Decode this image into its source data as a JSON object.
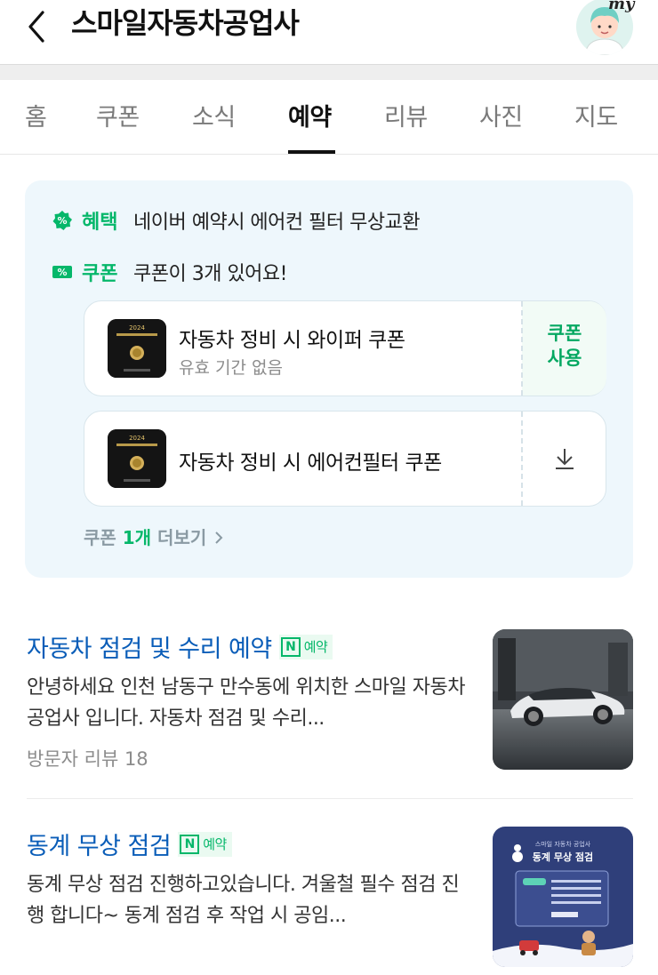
{
  "header": {
    "title": "스마일자동차공업사",
    "avatar_badge": "my",
    "icons": {
      "back": "chevron-left-icon",
      "avatar": "user-avatar-icon"
    }
  },
  "tabs": [
    {
      "label": "홈",
      "active": false
    },
    {
      "label": "쿠폰",
      "active": false
    },
    {
      "label": "소식",
      "active": false
    },
    {
      "label": "예약",
      "active": true
    },
    {
      "label": "리뷰",
      "active": false
    },
    {
      "label": "사진",
      "active": false
    },
    {
      "label": "지도",
      "active": false
    }
  ],
  "benefit": {
    "perk_label": "혜택",
    "perk_text": "네이버 예약시 에어컨 필터 무상교환",
    "coupon_label": "쿠폰",
    "coupon_text": "쿠폰이 3개 있어요!",
    "coupons": [
      {
        "name": "자동차 정비 시 와이퍼 쿠폰",
        "validity": "유효 기간 없음",
        "action_line1": "쿠폰",
        "action_line2": "사용",
        "thumb_year": "2024"
      },
      {
        "name": "자동차 정비 시 에어컨필터 쿠폰",
        "action_icon": "download-icon",
        "thumb_year": "2024"
      }
    ],
    "more_prefix": "쿠폰 ",
    "more_count": "1개",
    "more_suffix": " 더보기"
  },
  "bookings": [
    {
      "title": "자동차 점검 및 수리 예약",
      "badge": "예약",
      "desc": "안녕하세요 인천 남동구 만수동에 위치한 스마일 자동차 공업사 입니다. 자동차 점검 및 수리...",
      "meta": "방문자 리뷰 18"
    },
    {
      "title": "동계 무상 점검",
      "badge": "예약",
      "desc": "동계 무상 점검 진행하고있습니다. 겨울철 필수 점검 진행 합니다~ 동계 점검 후 작업 시 공임...",
      "poster_title": "동계 무상 점검",
      "poster_top": "스마일 자동차 공업사"
    }
  ],
  "colors": {
    "brand_green": "#05b76a",
    "link_blue": "#0a5db8",
    "card_bg": "#eef7fc"
  }
}
